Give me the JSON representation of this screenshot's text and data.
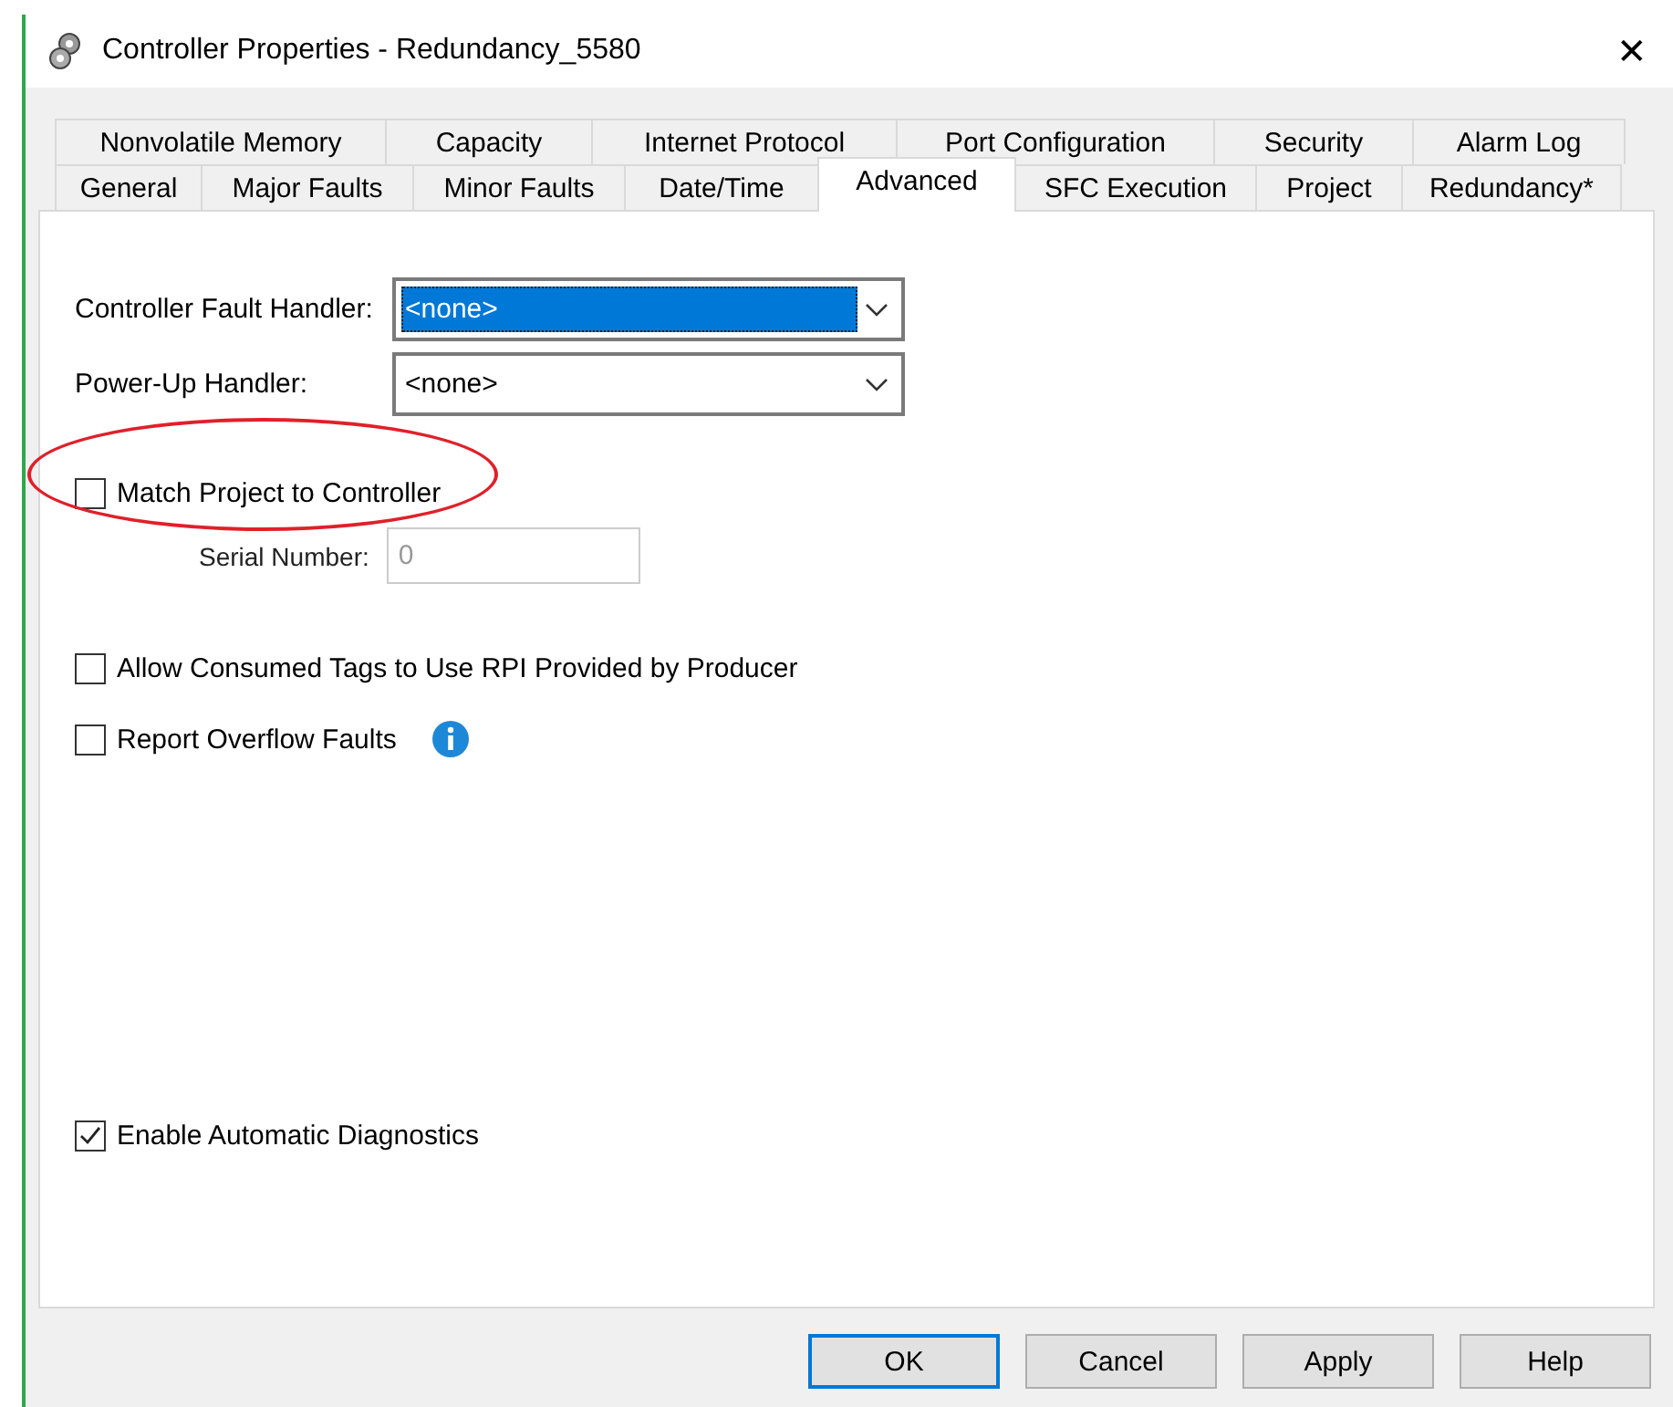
{
  "window": {
    "title": "Controller Properties - Redundancy_5580",
    "close": "✕"
  },
  "tabs": [
    [
      {
        "label": "Nonvolatile Memory",
        "selected": false
      },
      {
        "label": "Capacity",
        "selected": false
      },
      {
        "label": "Internet Protocol",
        "selected": false
      },
      {
        "label": "Port Configuration",
        "selected": false
      },
      {
        "label": "Security",
        "selected": false
      },
      {
        "label": "Alarm Log",
        "selected": false
      }
    ],
    [
      {
        "label": "General",
        "selected": false
      },
      {
        "label": "Major Faults",
        "selected": false
      },
      {
        "label": "Minor Faults",
        "selected": false
      },
      {
        "label": "Date/Time",
        "selected": false
      },
      {
        "label": "Advanced",
        "selected": true
      },
      {
        "label": "SFC Execution",
        "selected": false
      },
      {
        "label": "Project",
        "selected": false
      },
      {
        "label": "Redundancy*",
        "selected": false
      }
    ]
  ],
  "handlers": [
    {
      "label": "Controller Fault Handler:",
      "value": "<none>",
      "focused": true
    },
    {
      "label": "Power-Up Handler:",
      "value": "<none>",
      "focused": false
    }
  ],
  "options": [
    {
      "kind": "checkbox",
      "label": "Match Project to Controller",
      "checked": false,
      "circled": true,
      "info": false
    },
    {
      "kind": "field",
      "label": "Serial Number:",
      "value": "0",
      "disabled": true
    },
    {
      "kind": "checkbox",
      "label": "Allow Consumed Tags to Use RPI Provided by Producer",
      "checked": false,
      "circled": false,
      "info": false
    },
    {
      "kind": "checkbox",
      "label": "Report Overflow Faults",
      "checked": false,
      "circled": false,
      "info": true
    }
  ],
  "diagnostics": {
    "label": "Enable Automatic Diagnostics",
    "checked": true
  },
  "buttons": [
    {
      "label": "OK",
      "default": true
    },
    {
      "label": "Cancel",
      "default": false
    },
    {
      "label": "Apply",
      "default": false
    },
    {
      "label": "Help",
      "default": false
    }
  ]
}
